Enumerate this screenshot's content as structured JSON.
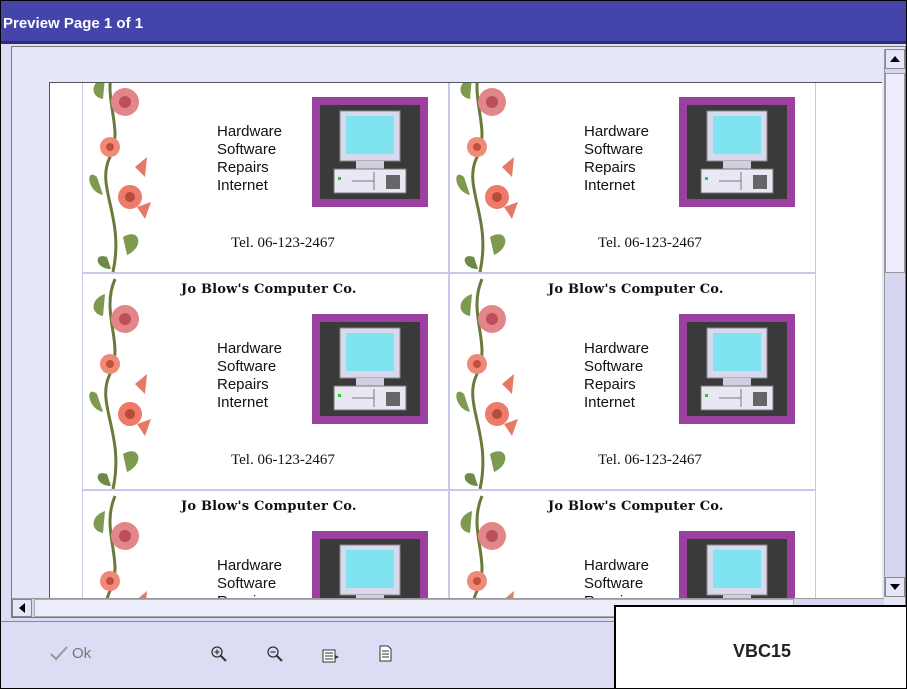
{
  "window": {
    "title": "Preview Page 1 of 1"
  },
  "card": {
    "company": "Jo Blow's Computer Co.",
    "services": [
      "Hardware",
      "Software",
      "Repairs",
      "Internet"
    ],
    "tel": "Tel. 06-123-2467"
  },
  "toolbar": {
    "ok_label": "Ok",
    "icons": [
      "zoom-in-icon",
      "zoom-out-icon",
      "page-width-icon",
      "full-page-icon"
    ]
  },
  "badge": {
    "code": "VBC15"
  },
  "colors": {
    "titlebar": "#4444aa",
    "frame_bg": "#dcdcf4",
    "computer_frame": "#9b3fa0",
    "screen": "#7fe3f0"
  }
}
